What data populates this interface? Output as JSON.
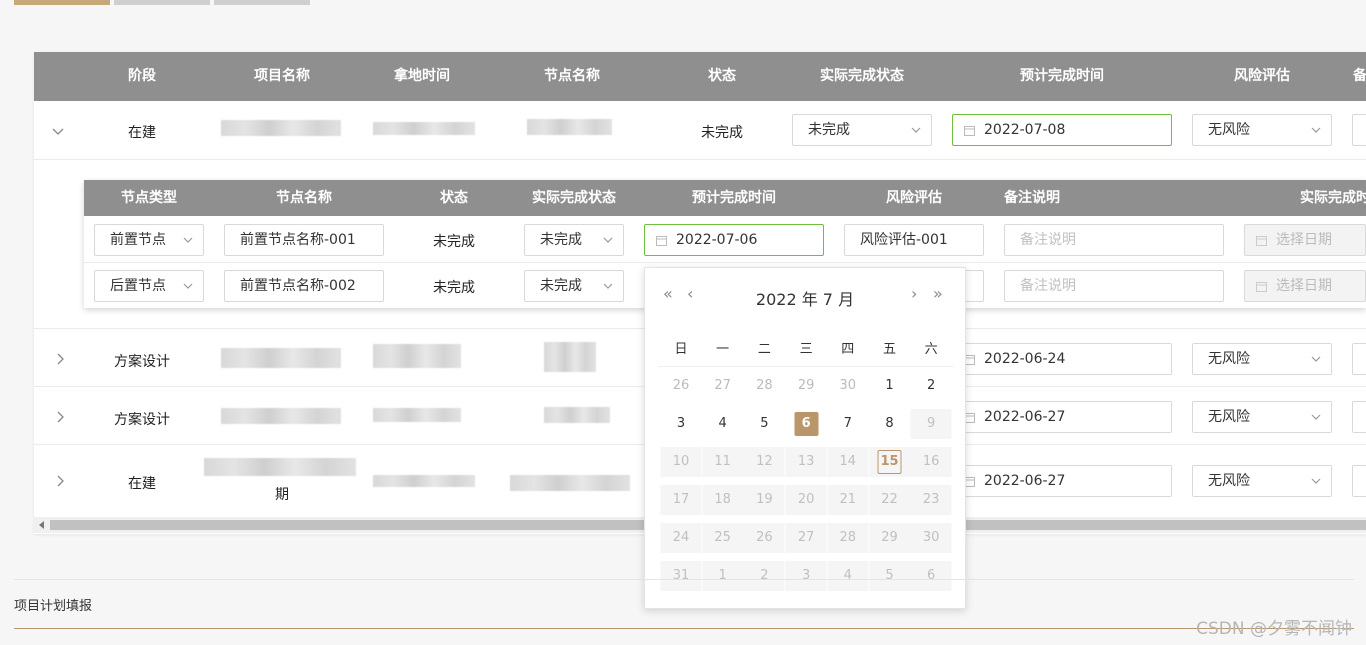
{
  "colors": {
    "accent": "#b9976a",
    "header_bg": "#8f8f8f",
    "focus_border": "#6fbf3a"
  },
  "main_table": {
    "headers": [
      "阶段",
      "项目名称",
      "拿地时间",
      "节点名称",
      "状态",
      "实际完成状态",
      "预计完成时间",
      "风险评估",
      "备"
    ],
    "rows": [
      {
        "stage": "在建",
        "status": "未完成",
        "actual_status": "未完成",
        "due_date": "2022-07-08",
        "risk": "无风险"
      },
      {
        "stage": "方案设计",
        "due_date": "2022-06-24",
        "risk": "无风险"
      },
      {
        "stage": "方案设计",
        "due_date": "2022-06-27",
        "risk": "无风险"
      },
      {
        "stage": "在建",
        "name_suffix": "期",
        "due_date": "2022-06-27",
        "risk": "无风险"
      }
    ]
  },
  "sub_table": {
    "headers": [
      "节点类型",
      "节点名称",
      "状态",
      "实际完成状态",
      "预计完成时间",
      "风险评估",
      "备注说明",
      "实际完成时间"
    ],
    "rows": [
      {
        "type": "前置节点",
        "name": "前置节点名称-001",
        "status": "未完成",
        "actual_status": "未完成",
        "due_date": "2022-07-06",
        "risk": "风险评估-001",
        "remark_placeholder": "备注说明",
        "actual_date_placeholder": "选择日期"
      },
      {
        "type": "后置节点",
        "name": "前置节点名称-002",
        "status": "未完成",
        "actual_status": "未完成",
        "remark_placeholder": "备注说明",
        "actual_date_placeholder": "选择日期"
      }
    ]
  },
  "calendar": {
    "title": "2022 年  7 月",
    "weekdays": [
      "日",
      "一",
      "二",
      "三",
      "四",
      "五",
      "六"
    ],
    "weeks": [
      [
        "26",
        "27",
        "28",
        "29",
        "30",
        "1",
        "2"
      ],
      [
        "3",
        "4",
        "5",
        "6",
        "7",
        "8",
        "9"
      ],
      [
        "10",
        "11",
        "12",
        "13",
        "14",
        "15",
        "16"
      ],
      [
        "17",
        "18",
        "19",
        "20",
        "21",
        "22",
        "23"
      ],
      [
        "24",
        "25",
        "26",
        "27",
        "28",
        "29",
        "30"
      ],
      [
        "31",
        "1",
        "2",
        "3",
        "4",
        "5",
        "6"
      ]
    ],
    "selected_day": "6",
    "today_day": "15"
  },
  "footer": {
    "section_title": "项目计划填报"
  },
  "watermark": "CSDN @夕雾不闻钟"
}
